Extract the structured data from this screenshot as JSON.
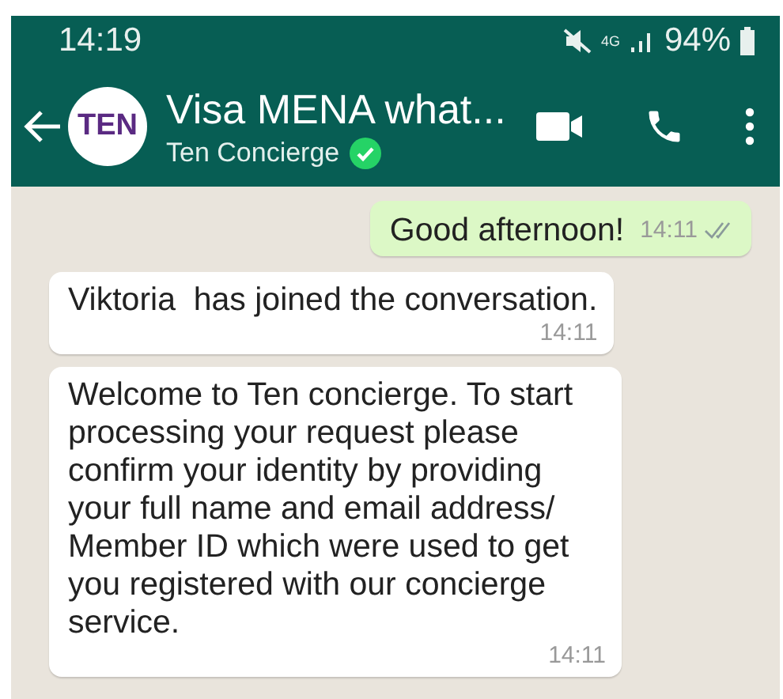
{
  "status_bar": {
    "time": "14:19",
    "network": "4G",
    "battery": "94%"
  },
  "header": {
    "title": "Visa MENA what...",
    "subtitle": "Ten Concierge",
    "verified": true,
    "avatar_text": "TEN"
  },
  "messages": [
    {
      "kind": "outgoing",
      "text": "Good afternoon!",
      "time": "14:11"
    },
    {
      "kind": "incoming",
      "text": "Viktoria  has joined the conversation.",
      "time": "14:11"
    },
    {
      "kind": "incoming",
      "text": "Welcome to Ten concierge. To start processing your request please confirm your identity by providing your full name and email address/ Member ID which were used to get you registered with our concierge service.",
      "time": "14:11"
    }
  ]
}
